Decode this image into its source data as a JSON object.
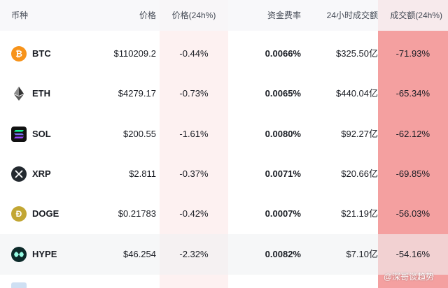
{
  "header": {
    "coin": "币种",
    "price": "价格",
    "price_change": "价格(24h%)",
    "funding_rate": "资金费率",
    "volume": "24小时成交额",
    "volume_change": "成交额(24h%)"
  },
  "rows": [
    {
      "symbol": "BTC",
      "icon": "bitcoin-icon",
      "price": "$110209.2",
      "price_change": "-0.44%",
      "funding_rate": "0.0066%",
      "volume": "$325.50亿",
      "volume_change": "-71.93%"
    },
    {
      "symbol": "ETH",
      "icon": "ethereum-icon",
      "price": "$4279.17",
      "price_change": "-0.73%",
      "funding_rate": "0.0065%",
      "volume": "$440.04亿",
      "volume_change": "-65.34%"
    },
    {
      "symbol": "SOL",
      "icon": "solana-icon",
      "price": "$200.55",
      "price_change": "-1.61%",
      "funding_rate": "0.0080%",
      "volume": "$92.27亿",
      "volume_change": "-62.12%"
    },
    {
      "symbol": "XRP",
      "icon": "xrp-icon",
      "price": "$2.811",
      "price_change": "-0.37%",
      "funding_rate": "0.0071%",
      "volume": "$20.66亿",
      "volume_change": "-69.85%"
    },
    {
      "symbol": "DOGE",
      "icon": "dogecoin-icon",
      "price": "$0.21783",
      "price_change": "-0.42%",
      "funding_rate": "0.0007%",
      "volume": "$21.19亿",
      "volume_change": "-56.03%"
    },
    {
      "symbol": "HYPE",
      "icon": "hyperliquid-icon",
      "price": "$46.254",
      "price_change": "-2.32%",
      "funding_rate": "0.0082%",
      "volume": "$7.10亿",
      "volume_change": "-54.16%"
    }
  ],
  "watermark": "@深哥谈趋势",
  "colors": {
    "up": "#18b46a",
    "down_highlight": "#f4a0a0",
    "price_col_highlight": "#fdf1f1"
  }
}
